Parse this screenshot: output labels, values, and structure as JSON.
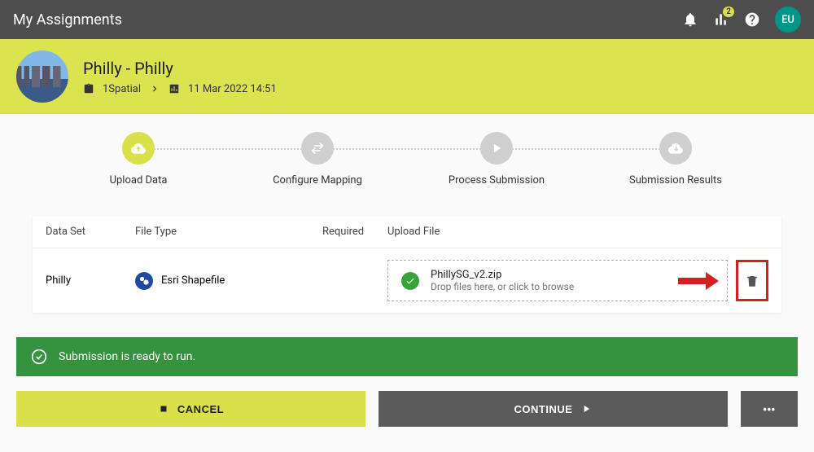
{
  "topbar": {
    "title": "My Assignments",
    "badge_count": "2",
    "user_initials": "EU"
  },
  "header": {
    "title": "Philly - Philly",
    "org": "1Spatial",
    "timestamp": "11 Mar 2022 14:51"
  },
  "stepper": [
    {
      "label": "Upload Data"
    },
    {
      "label": "Configure Mapping"
    },
    {
      "label": "Process Submission"
    },
    {
      "label": "Submission Results"
    }
  ],
  "table": {
    "headers": {
      "dataset": "Data Set",
      "filetype": "File Type",
      "required": "Required",
      "upload": "Upload File"
    },
    "row": {
      "dataset": "Philly",
      "filetype": "Esri Shapefile",
      "filename": "PhillySG_v2.zip",
      "hint": "Drop files here, or click to browse"
    }
  },
  "banner": {
    "text": "Submission is ready to run."
  },
  "buttons": {
    "cancel": "CANCEL",
    "continue": "CONTINUE",
    "menu": "•••"
  }
}
